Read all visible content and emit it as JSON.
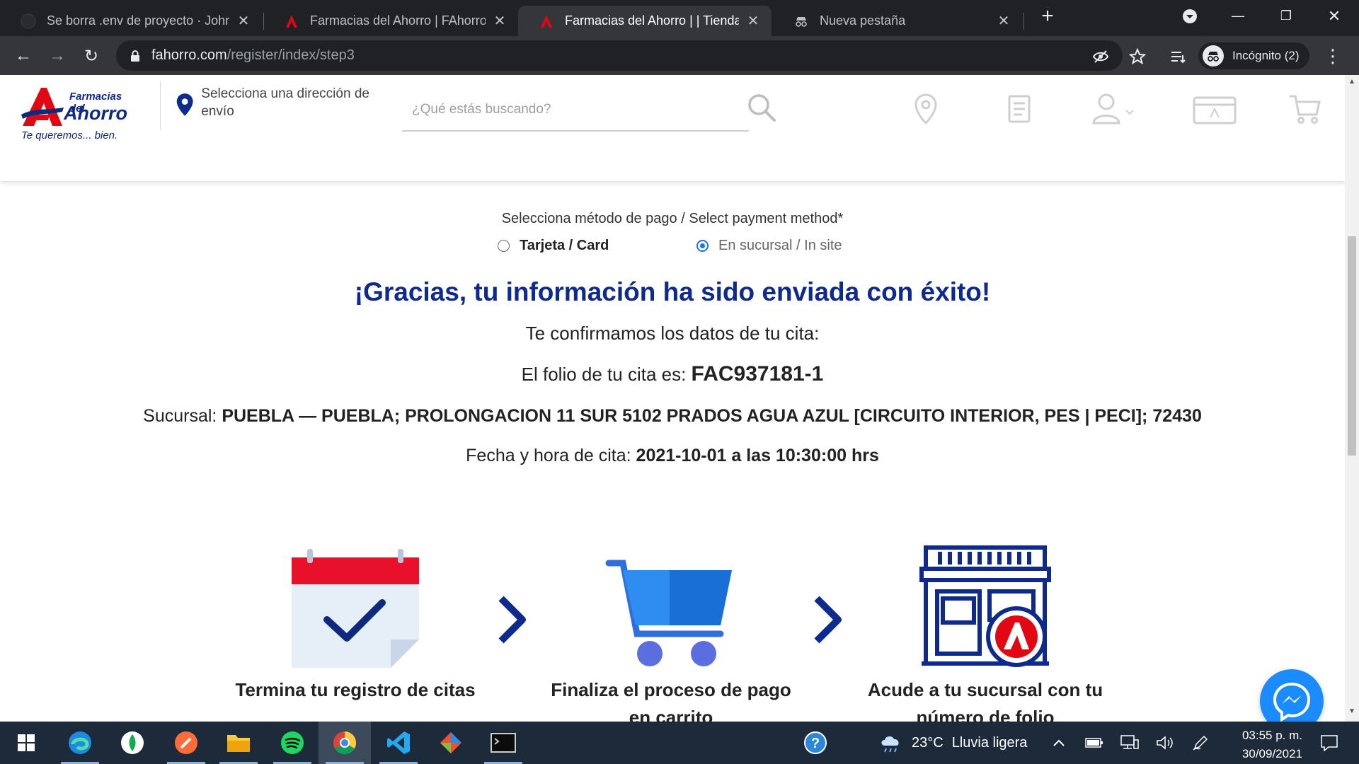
{
  "browser": {
    "tabs": [
      {
        "title": "Se borra .env de proyecto · JohnF",
        "active": false
      },
      {
        "title": "Farmacias del Ahorro | FAhorro | F",
        "active": false
      },
      {
        "title": "Farmacias del Ahorro | | Tienda en",
        "active": true
      },
      {
        "title": "Nueva pestaña",
        "active": false
      }
    ],
    "url_host": "fahorro.com",
    "url_path": "/register/index/step3",
    "profile_label": "Incógnito (2)"
  },
  "header": {
    "logo": {
      "top": "Farmacias del",
      "main": "Ahorro",
      "tagline": "Te queremos... bien."
    },
    "address_prompt": "Selecciona una dirección de envío",
    "search_placeholder": "¿Qué estás buscando?"
  },
  "payment": {
    "label": "Selecciona método de pago / Select payment method",
    "required_mark": "*",
    "options": [
      {
        "label": "Tarjeta / Card",
        "selected": false
      },
      {
        "label": "En sucursal / In site",
        "selected": true
      }
    ]
  },
  "confirmation": {
    "title": "¡Gracias, tu información ha sido enviada con éxito!",
    "subtitle": "Te confirmamos los datos de tu cita:",
    "folio_label": "El folio de tu cita es: ",
    "folio_value": "FAC937181-1",
    "branch_label": "Sucursal: ",
    "branch_value": "PUEBLA — PUEBLA; PROLONGACION 11 SUR 5102 PRADOS AGUA AZUL [CIRCUITO INTERIOR, PES | PECI]; 72430",
    "datetime_label": "Fecha y hora de cita: ",
    "datetime_value": "2021-10-01 a las 10:30:00 hrs"
  },
  "steps": [
    {
      "label": "Termina tu registro de citas",
      "icon": "calendar-check-icon"
    },
    {
      "label": "Finaliza el proceso de pago en carrito",
      "icon": "shopping-cart-icon"
    },
    {
      "label": "Acude a tu sucursal con tu número de folio",
      "icon": "store-icon"
    }
  ],
  "taskbar": {
    "weather_temp": "23°C",
    "weather_desc": "Lluvia ligera",
    "time": "03:55 p. m.",
    "date": "30/09/2021"
  },
  "colors": {
    "brand_blue": "#0d2a8c",
    "brand_red": "#e30613",
    "radio_blue": "#1a73e8",
    "messenger": "#1a8cff"
  }
}
